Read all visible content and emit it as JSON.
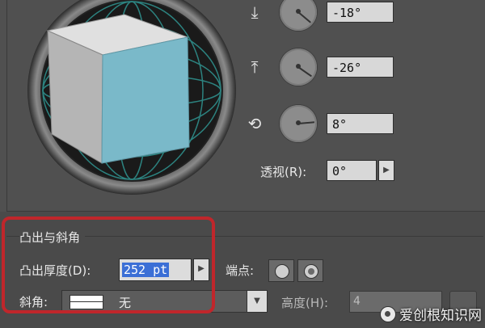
{
  "rotation": {
    "x_axis": {
      "icon": "rotate-x-axis-icon",
      "value": "-18°"
    },
    "y_axis": {
      "icon": "rotate-y-axis-icon",
      "value": "-26°"
    },
    "z_axis": {
      "icon": "rotate-z-axis-icon",
      "value": "8°"
    }
  },
  "perspective": {
    "label": "透视(R):",
    "value": "0°"
  },
  "extrude_bevel": {
    "section_title": "凸出与斜角",
    "depth_label": "凸出厚度(D):",
    "depth_value": "252 pt",
    "cap_label": "端点:",
    "bevel_label": "斜角:",
    "bevel_value": "无",
    "height_label": "高度(H):",
    "height_value": "4"
  },
  "watermark": "爱创根知识网",
  "colors": {
    "highlight": "#c0262b",
    "cube_front": "#7ab9c9",
    "cube_top": "#e0e0e0",
    "cube_side": "#b5b5b5",
    "selection": "#3b6fd6"
  }
}
